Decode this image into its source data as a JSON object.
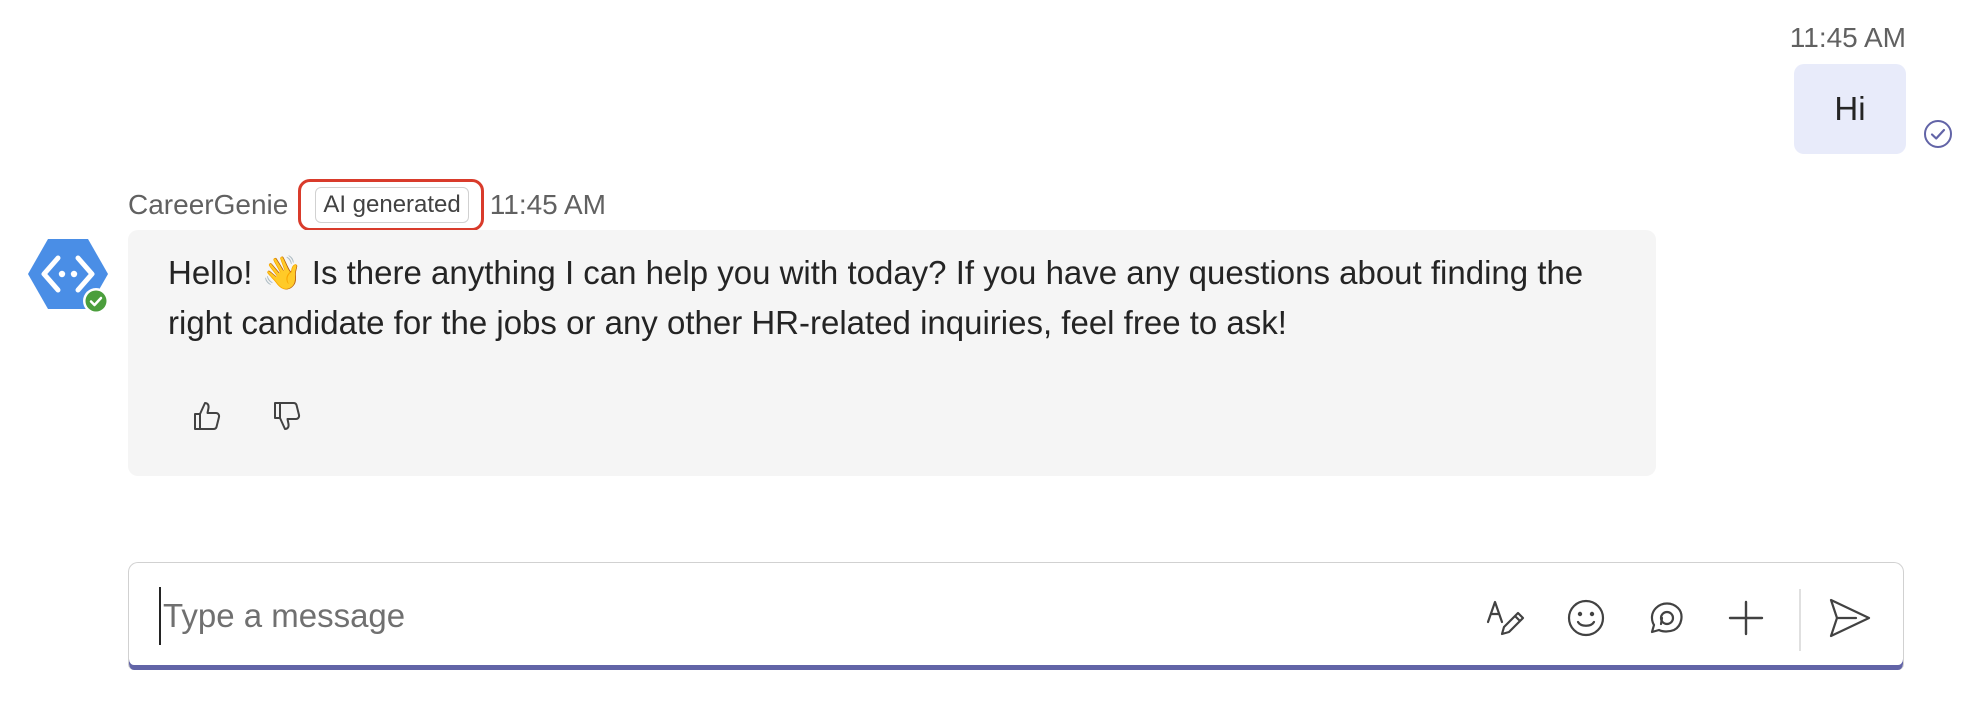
{
  "outgoing": {
    "time": "11:45 AM",
    "text": "Hi"
  },
  "incoming": {
    "sender": "CareerGenie",
    "badge": "AI generated",
    "time": "11:45 AM",
    "text": "Hello! 👋 Is there anything I can help you with today? If you have any questions about finding the right candidate for the jobs or any other HR-related inquiries, feel free to ask!"
  },
  "compose": {
    "placeholder": "Type a message"
  },
  "icons": {
    "avatar": "bot-avatar-icon",
    "status": "available-status-icon",
    "read_receipt": "read-receipt-icon",
    "like": "thumbs-up-icon",
    "dislike": "thumbs-down-icon",
    "format": "format-icon",
    "emoji": "emoji-icon",
    "loop": "loop-icon",
    "plus": "plus-icon",
    "send": "send-icon"
  },
  "colors": {
    "accent": "#6264a7",
    "avatar_blue": "#4a8ee6",
    "status_green": "#4b9e3c",
    "highlight_red": "#d93b2b",
    "outgoing_bubble": "#e8ebfa",
    "incoming_bubble": "#f5f5f5"
  }
}
